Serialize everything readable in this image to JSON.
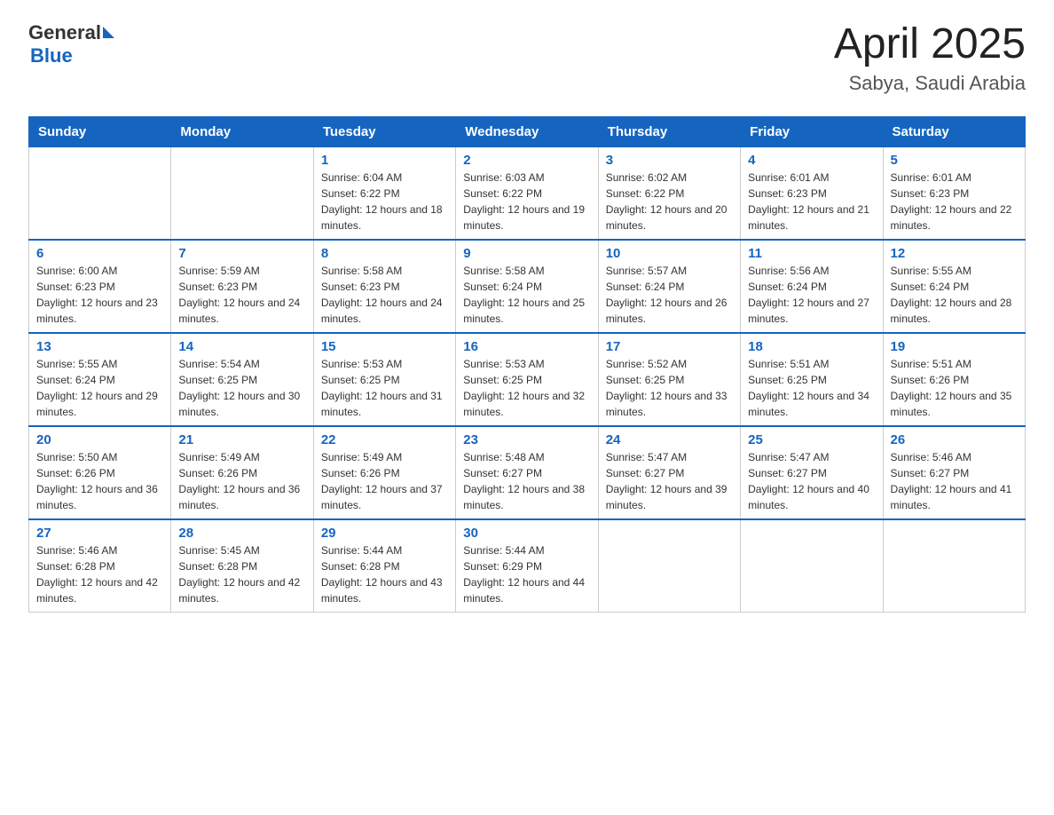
{
  "header": {
    "logo_general": "General",
    "logo_blue": "Blue",
    "title": "April 2025",
    "subtitle": "Sabya, Saudi Arabia"
  },
  "days_of_week": [
    "Sunday",
    "Monday",
    "Tuesday",
    "Wednesday",
    "Thursday",
    "Friday",
    "Saturday"
  ],
  "weeks": [
    [
      {
        "day": "",
        "sunrise": "",
        "sunset": "",
        "daylight": ""
      },
      {
        "day": "",
        "sunrise": "",
        "sunset": "",
        "daylight": ""
      },
      {
        "day": "1",
        "sunrise": "Sunrise: 6:04 AM",
        "sunset": "Sunset: 6:22 PM",
        "daylight": "Daylight: 12 hours and 18 minutes."
      },
      {
        "day": "2",
        "sunrise": "Sunrise: 6:03 AM",
        "sunset": "Sunset: 6:22 PM",
        "daylight": "Daylight: 12 hours and 19 minutes."
      },
      {
        "day": "3",
        "sunrise": "Sunrise: 6:02 AM",
        "sunset": "Sunset: 6:22 PM",
        "daylight": "Daylight: 12 hours and 20 minutes."
      },
      {
        "day": "4",
        "sunrise": "Sunrise: 6:01 AM",
        "sunset": "Sunset: 6:23 PM",
        "daylight": "Daylight: 12 hours and 21 minutes."
      },
      {
        "day": "5",
        "sunrise": "Sunrise: 6:01 AM",
        "sunset": "Sunset: 6:23 PM",
        "daylight": "Daylight: 12 hours and 22 minutes."
      }
    ],
    [
      {
        "day": "6",
        "sunrise": "Sunrise: 6:00 AM",
        "sunset": "Sunset: 6:23 PM",
        "daylight": "Daylight: 12 hours and 23 minutes."
      },
      {
        "day": "7",
        "sunrise": "Sunrise: 5:59 AM",
        "sunset": "Sunset: 6:23 PM",
        "daylight": "Daylight: 12 hours and 24 minutes."
      },
      {
        "day": "8",
        "sunrise": "Sunrise: 5:58 AM",
        "sunset": "Sunset: 6:23 PM",
        "daylight": "Daylight: 12 hours and 24 minutes."
      },
      {
        "day": "9",
        "sunrise": "Sunrise: 5:58 AM",
        "sunset": "Sunset: 6:24 PM",
        "daylight": "Daylight: 12 hours and 25 minutes."
      },
      {
        "day": "10",
        "sunrise": "Sunrise: 5:57 AM",
        "sunset": "Sunset: 6:24 PM",
        "daylight": "Daylight: 12 hours and 26 minutes."
      },
      {
        "day": "11",
        "sunrise": "Sunrise: 5:56 AM",
        "sunset": "Sunset: 6:24 PM",
        "daylight": "Daylight: 12 hours and 27 minutes."
      },
      {
        "day": "12",
        "sunrise": "Sunrise: 5:55 AM",
        "sunset": "Sunset: 6:24 PM",
        "daylight": "Daylight: 12 hours and 28 minutes."
      }
    ],
    [
      {
        "day": "13",
        "sunrise": "Sunrise: 5:55 AM",
        "sunset": "Sunset: 6:24 PM",
        "daylight": "Daylight: 12 hours and 29 minutes."
      },
      {
        "day": "14",
        "sunrise": "Sunrise: 5:54 AM",
        "sunset": "Sunset: 6:25 PM",
        "daylight": "Daylight: 12 hours and 30 minutes."
      },
      {
        "day": "15",
        "sunrise": "Sunrise: 5:53 AM",
        "sunset": "Sunset: 6:25 PM",
        "daylight": "Daylight: 12 hours and 31 minutes."
      },
      {
        "day": "16",
        "sunrise": "Sunrise: 5:53 AM",
        "sunset": "Sunset: 6:25 PM",
        "daylight": "Daylight: 12 hours and 32 minutes."
      },
      {
        "day": "17",
        "sunrise": "Sunrise: 5:52 AM",
        "sunset": "Sunset: 6:25 PM",
        "daylight": "Daylight: 12 hours and 33 minutes."
      },
      {
        "day": "18",
        "sunrise": "Sunrise: 5:51 AM",
        "sunset": "Sunset: 6:25 PM",
        "daylight": "Daylight: 12 hours and 34 minutes."
      },
      {
        "day": "19",
        "sunrise": "Sunrise: 5:51 AM",
        "sunset": "Sunset: 6:26 PM",
        "daylight": "Daylight: 12 hours and 35 minutes."
      }
    ],
    [
      {
        "day": "20",
        "sunrise": "Sunrise: 5:50 AM",
        "sunset": "Sunset: 6:26 PM",
        "daylight": "Daylight: 12 hours and 36 minutes."
      },
      {
        "day": "21",
        "sunrise": "Sunrise: 5:49 AM",
        "sunset": "Sunset: 6:26 PM",
        "daylight": "Daylight: 12 hours and 36 minutes."
      },
      {
        "day": "22",
        "sunrise": "Sunrise: 5:49 AM",
        "sunset": "Sunset: 6:26 PM",
        "daylight": "Daylight: 12 hours and 37 minutes."
      },
      {
        "day": "23",
        "sunrise": "Sunrise: 5:48 AM",
        "sunset": "Sunset: 6:27 PM",
        "daylight": "Daylight: 12 hours and 38 minutes."
      },
      {
        "day": "24",
        "sunrise": "Sunrise: 5:47 AM",
        "sunset": "Sunset: 6:27 PM",
        "daylight": "Daylight: 12 hours and 39 minutes."
      },
      {
        "day": "25",
        "sunrise": "Sunrise: 5:47 AM",
        "sunset": "Sunset: 6:27 PM",
        "daylight": "Daylight: 12 hours and 40 minutes."
      },
      {
        "day": "26",
        "sunrise": "Sunrise: 5:46 AM",
        "sunset": "Sunset: 6:27 PM",
        "daylight": "Daylight: 12 hours and 41 minutes."
      }
    ],
    [
      {
        "day": "27",
        "sunrise": "Sunrise: 5:46 AM",
        "sunset": "Sunset: 6:28 PM",
        "daylight": "Daylight: 12 hours and 42 minutes."
      },
      {
        "day": "28",
        "sunrise": "Sunrise: 5:45 AM",
        "sunset": "Sunset: 6:28 PM",
        "daylight": "Daylight: 12 hours and 42 minutes."
      },
      {
        "day": "29",
        "sunrise": "Sunrise: 5:44 AM",
        "sunset": "Sunset: 6:28 PM",
        "daylight": "Daylight: 12 hours and 43 minutes."
      },
      {
        "day": "30",
        "sunrise": "Sunrise: 5:44 AM",
        "sunset": "Sunset: 6:29 PM",
        "daylight": "Daylight: 12 hours and 44 minutes."
      },
      {
        "day": "",
        "sunrise": "",
        "sunset": "",
        "daylight": ""
      },
      {
        "day": "",
        "sunrise": "",
        "sunset": "",
        "daylight": ""
      },
      {
        "day": "",
        "sunrise": "",
        "sunset": "",
        "daylight": ""
      }
    ]
  ]
}
